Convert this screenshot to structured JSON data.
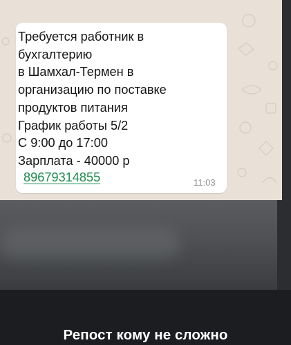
{
  "message": {
    "lines": [
      "Требуется работник в",
      "бухгалтерию",
      "в Шамхал-Термен в",
      "организацию по поставке",
      "продуктов питания",
      "График работы 5/2",
      "С 9:00 до 17:00",
      "Зарплата - 40000 р"
    ],
    "phone": "89679314855",
    "time": "11:03"
  },
  "caption": "Репост кому не сложно",
  "colors": {
    "chat_background": "#e9e1d7",
    "bubble": "#ffffff",
    "link": "#1d8a4d",
    "overlay": "#1b1d20"
  }
}
